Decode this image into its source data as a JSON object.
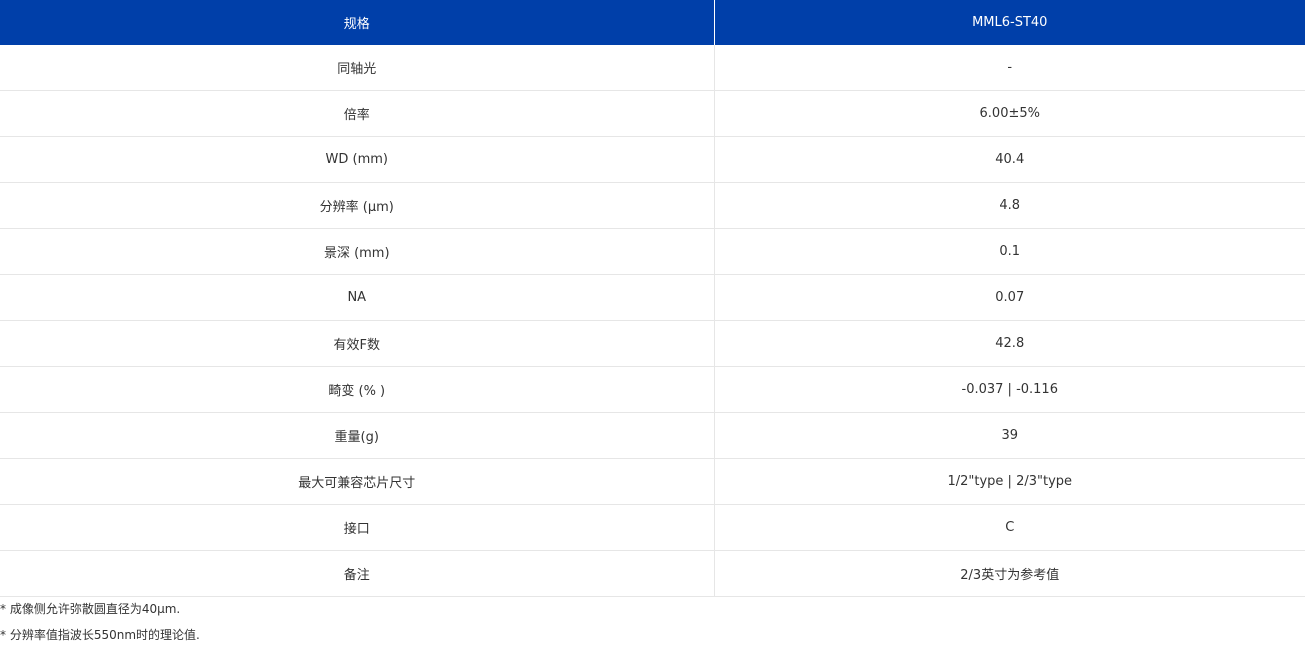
{
  "table": {
    "headers": [
      "规格",
      "MML6-ST40"
    ],
    "rows": [
      [
        "同轴光",
        "-"
      ],
      [
        "倍率",
        "6.00±5%"
      ],
      [
        "WD (mm)",
        "40.4"
      ],
      [
        "分辨率 (µm)",
        "4.8"
      ],
      [
        "景深 (mm)",
        "0.1"
      ],
      [
        "NA",
        "0.07"
      ],
      [
        "有效F数",
        "42.8"
      ],
      [
        "畸变 (% )",
        "-0.037 | -0.116"
      ],
      [
        "重量(g)",
        "39"
      ],
      [
        "最大可兼容芯片尺寸",
        "1/2\"type | 2/3\"type"
      ],
      [
        "接口",
        "C"
      ],
      [
        "备注",
        "2/3英寸为参考值"
      ]
    ]
  },
  "notes": [
    "* 成像侧允许弥散圆直径为40µm.",
    "* 分辨率值指波长550nm时的理论值."
  ],
  "colors": {
    "header_bg": "#003fa9",
    "header_text": "#ffffff",
    "row_border": "#e6e6e6"
  }
}
